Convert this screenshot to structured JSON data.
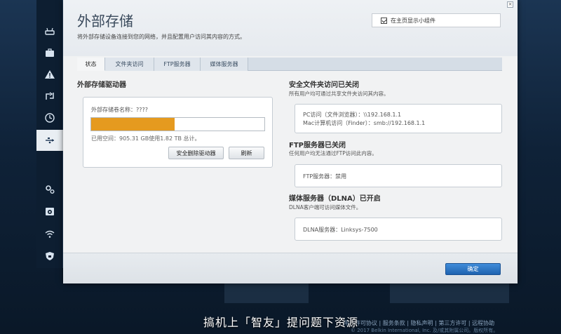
{
  "app": {
    "title": "外部存储",
    "subtitle": "将外部存储设备连接到您的网络，并且配置用户访问其内容的方式。",
    "close_glyph": "×"
  },
  "widget_toggle": {
    "label": "在主页显示小组件",
    "checked": true
  },
  "tabs": [
    {
      "label": "状态",
      "active": true
    },
    {
      "label": "文件夹访问",
      "active": false
    },
    {
      "label": "FTP服务器",
      "active": false
    },
    {
      "label": "媒体服务器",
      "active": false
    }
  ],
  "drive": {
    "heading": "外部存储驱动器",
    "volume_name": "外部存储卷名称：????",
    "usage_fraction": 0.48,
    "used_text": "已用空间：905.31 GB使用1.82 TB 总计。",
    "eject_label": "安全删除驱动器",
    "refresh_label": "刷新"
  },
  "secure_folder": {
    "heading": "安全文件夹访问已关闭",
    "desc": "所有用户均可通过共享文件夹访问其内容。",
    "pc_line": "PC访问（文件浏览器）：\\\\192.168.1.1",
    "mac_line": "Mac计算机访问（Finder）：smb://192.168.1.1"
  },
  "ftp": {
    "heading": "FTP服务器已关闭",
    "desc": "任何用户均无法通过FTP访问此内容。",
    "line": "FTP服务器：禁用"
  },
  "dlna": {
    "heading": "媒体服务器（DLNA）已开启",
    "desc": "DLNA客户端可访问媒体文件。",
    "line": "DLNA服务器：Linksys-7500"
  },
  "footer": {
    "ok_label": "确定"
  },
  "background": {
    "footer_links": "用户许可协议 | 服务条款 | 隐私声明 | 第三方许可 | 远程协助",
    "copyright": "© 2017 Belkin International, Inc. 及/或其附属公司。版权所有。",
    "watermark": "搞机上「智友」提问题下资源"
  },
  "sidebar": {
    "icons": [
      "router-icon",
      "briefcase-icon",
      "warning-icon",
      "priority-icon",
      "clock-icon",
      "usb-icon",
      "settings-icon",
      "backup-icon",
      "wifi-icon",
      "shield-icon"
    ],
    "active": "usb-icon"
  },
  "colors": {
    "usage_bar": "#e59a1f",
    "ok_button": "#1f63b0"
  }
}
